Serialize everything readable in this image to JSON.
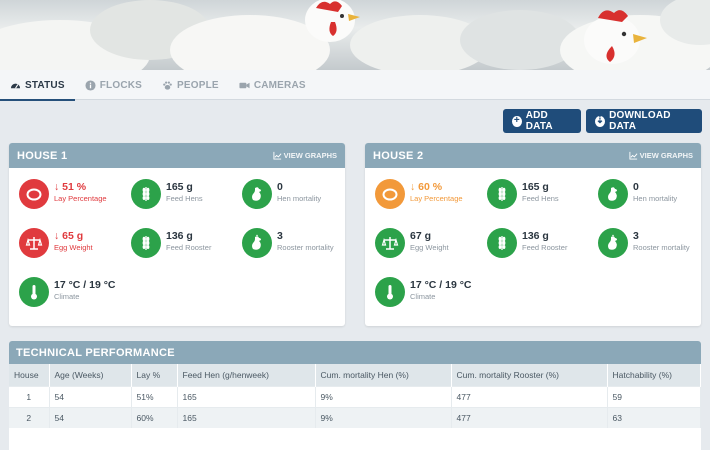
{
  "tabs": [
    {
      "label": "STATUS",
      "icon": "dashboard-icon",
      "active": true
    },
    {
      "label": "FLOCKS",
      "icon": "info-icon",
      "active": false
    },
    {
      "label": "PEOPLE",
      "icon": "paw-icon",
      "active": false
    },
    {
      "label": "CAMERAS",
      "icon": "camera-icon",
      "active": false
    }
  ],
  "buttons": {
    "add_data": "ADD DATA",
    "download_data": "DOWNLOAD DATA"
  },
  "houses": [
    {
      "title": "HOUSE 1",
      "view_graphs": "VIEW GRAPHS",
      "lay_value": "↓ 51 %",
      "lay_label": "Lay Percentage",
      "egg_value": "↓ 65 g",
      "egg_label": "Egg Weight",
      "climate_value": "17 °C / 19 °C",
      "climate_label": "Climate",
      "feed_hens_value": "165 g",
      "feed_hens_label": "Feed Hens",
      "feed_rooster_value": "136 g",
      "feed_rooster_label": "Feed Rooster",
      "hen_mort_value": "0",
      "hen_mort_label": "Hen mortality",
      "rooster_mort_value": "3",
      "rooster_mort_label": "Rooster mortality"
    },
    {
      "title": "HOUSE 2",
      "view_graphs": "VIEW GRAPHS",
      "lay_value": "↓ 60 %",
      "lay_label": "Lay Percentage",
      "egg_value": "67 g",
      "egg_label": "Egg Weight",
      "climate_value": "17 °C / 19 °C",
      "climate_label": "Climate",
      "feed_hens_value": "165 g",
      "feed_hens_label": "Feed Hens",
      "feed_rooster_value": "136 g",
      "feed_rooster_label": "Feed Rooster",
      "hen_mort_value": "0",
      "hen_mort_label": "Hen mortality",
      "rooster_mort_value": "3",
      "rooster_mort_label": "Rooster mortality"
    }
  ],
  "colors": {
    "good": "#2ca24a",
    "bad": "#e03a3e",
    "warn": "#f2993a",
    "header": "#8ba8b8",
    "button": "#1f4c7a"
  },
  "tech": {
    "title": "TECHNICAL PERFORMANCE",
    "columns": [
      "House",
      "Age (Weeks)",
      "Lay %",
      "Feed Hen (g/henweek)",
      "Cum. mortality Hen (%)",
      "Cum. mortality Rooster (%)",
      "Hatchability (%)"
    ],
    "rows": [
      [
        "1",
        "54",
        "51%",
        "165",
        "9%",
        "477",
        "59"
      ],
      [
        "2",
        "54",
        "60%",
        "165",
        "9%",
        "477",
        "63"
      ]
    ]
  }
}
